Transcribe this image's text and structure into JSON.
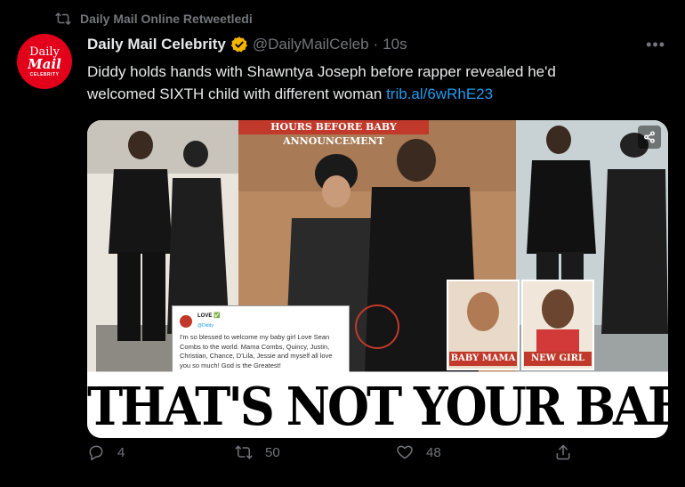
{
  "retweet": {
    "label": "Daily Mail Online Retweetledi",
    "icon": "retweet-icon"
  },
  "avatar": {
    "line1": "Daily",
    "line2": "Mail",
    "line3": "CELEBRITY"
  },
  "tweet": {
    "author_name": "Daily Mail Celebrity",
    "handle": "@DailyMailCeleb",
    "separator": "·",
    "time": "10s",
    "text": "Diddy holds hands with Shawntya Joseph before rapper revealed he'd welcomed SIXTH child with different woman",
    "link": "trib.al/6wRhE23"
  },
  "media": {
    "banner": "HOURS BEFORE BABY ANNOUNCEMENT",
    "quote": {
      "name": "LOVE ✅",
      "sub": "@Diddy",
      "text": "I'm so blessed to welcome my baby girl Love Sean Combs to the world. Mama Combs, Quincy, Justin, Christian, Chance, D'Lila, Jessie and myself all love you so much! God is the Greatest!"
    },
    "label_left": "BABY MAMA",
    "label_right": "NEW GIRL",
    "headline": "THAT'S NOT YOUR BABY MAMA!"
  },
  "actions": {
    "replies": "4",
    "retweets": "50",
    "likes": "48"
  },
  "colors": {
    "link": "#1d9bf0",
    "muted": "#71767b",
    "verified": "#f4b400",
    "accent_red": "#c0392b"
  }
}
